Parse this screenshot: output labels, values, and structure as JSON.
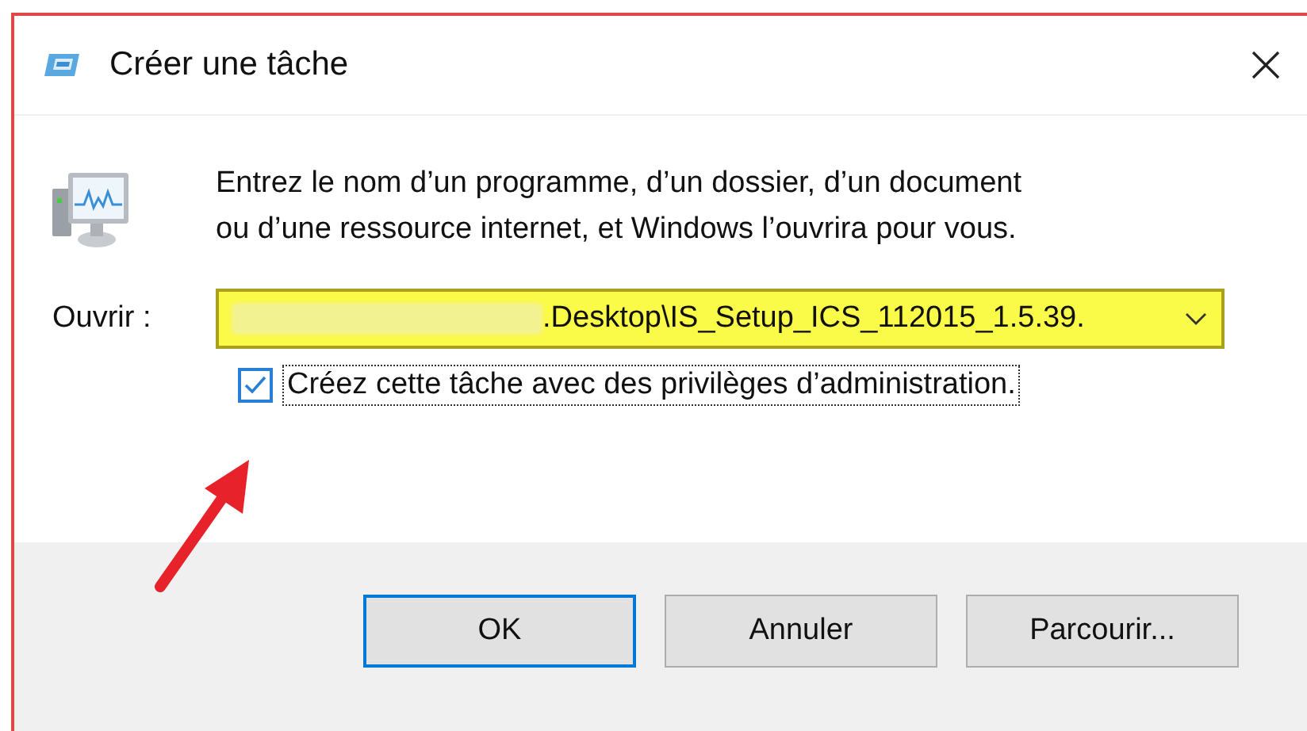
{
  "window": {
    "title": "Créer une tâche"
  },
  "description": "Entrez le nom d’un programme, d’un dossier, d’un document ou d’une ressource internet, et Windows l’ouvrira pour vous.",
  "open_field": {
    "label": "Ouvrir :",
    "value": ".Desktop\\IS_Setup_ICS_112015_1.5.39.",
    "redacted": true,
    "highlighted": true
  },
  "admin_checkbox": {
    "label": "Créez cette tâche avec des privilèges d’administration.",
    "checked": true,
    "focused": true
  },
  "buttons": [
    {
      "label": "OK",
      "default": true
    },
    {
      "label": "Annuler",
      "default": false
    },
    {
      "label": "Parcourir...",
      "default": false
    }
  ],
  "annotation": {
    "kind": "arrow"
  }
}
